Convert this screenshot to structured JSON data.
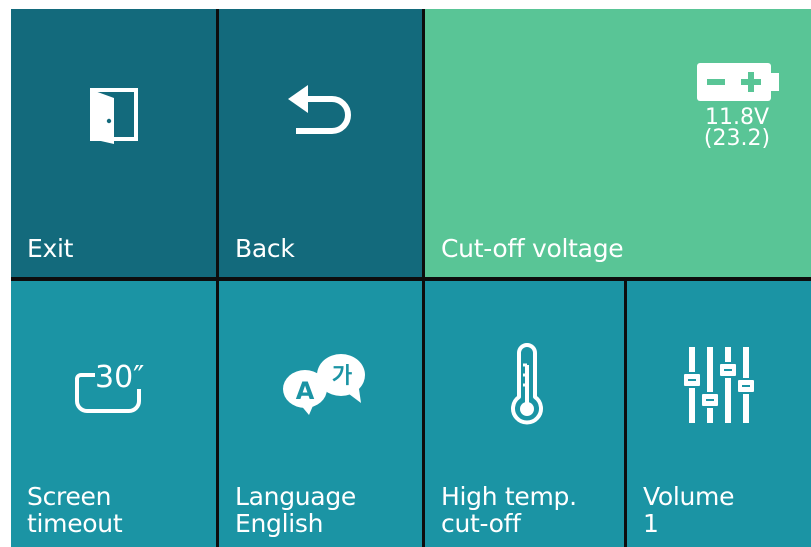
{
  "tiles": {
    "exit": {
      "label": "Exit",
      "icon": "exit-door-icon"
    },
    "back": {
      "label": "Back",
      "icon": "back-arrow-icon"
    },
    "cutoff": {
      "label": "Cut-off voltage",
      "icon": "battery-icon",
      "voltage": "11.8V",
      "voltage_sub": "(23.2)"
    },
    "screen": {
      "label": "Screen\ntimeout",
      "icon": "screen-timeout-icon",
      "timeout_value": "30″"
    },
    "language": {
      "label": "Language\nEnglish",
      "icon": "language-icon",
      "badge_a": "A",
      "badge_b": "가"
    },
    "hightemp": {
      "label": "High temp.\ncut-off",
      "icon": "thermometer-icon"
    },
    "volume": {
      "label": "Volume\n1",
      "icon": "equalizer-sliders-icon"
    }
  },
  "colors": {
    "tile_dark": "#136a7c",
    "tile_green": "#59c596",
    "tile_teal": "#1b94a4",
    "divider": "#0d0d0d",
    "foreground": "#ffffff"
  }
}
